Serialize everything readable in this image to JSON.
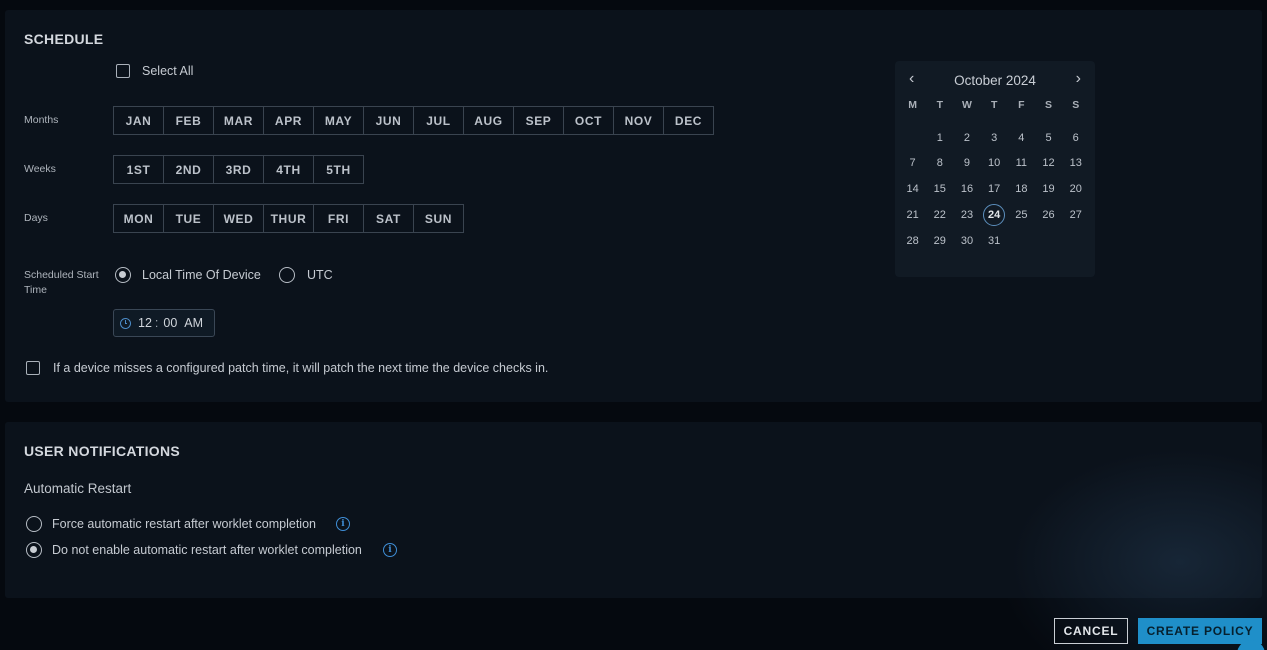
{
  "schedule": {
    "title": "SCHEDULE",
    "select_all": "Select All",
    "months_label": "Months",
    "months": [
      "JAN",
      "FEB",
      "MAR",
      "APR",
      "MAY",
      "JUN",
      "JUL",
      "AUG",
      "SEP",
      "OCT",
      "NOV",
      "DEC"
    ],
    "weeks_label": "Weeks",
    "weeks": [
      "1ST",
      "2ND",
      "3RD",
      "4TH",
      "5TH"
    ],
    "days_label": "Days",
    "days": [
      "MON",
      "TUE",
      "WED",
      "THUR",
      "FRI",
      "SAT",
      "SUN"
    ],
    "start_time_label": "Scheduled Start Time",
    "tz_local": "Local Time Of Device",
    "tz_utc": "UTC",
    "time_hour": "12",
    "time_minute": "00",
    "time_ampm": "AM",
    "missed_patch": "If a device misses a configured patch time, it will patch the next time the device checks in."
  },
  "calendar": {
    "month_label": "October 2024",
    "prev_icon": "chevron-left-icon",
    "next_icon": "chevron-right-icon",
    "weekdays": [
      "M",
      "T",
      "W",
      "T",
      "F",
      "S",
      "S"
    ],
    "first_weekday_offset": 1,
    "days_in_month": 31,
    "today": 24
  },
  "notifications": {
    "title": "USER NOTIFICATIONS",
    "subtitle": "Automatic Restart",
    "option_force": "Force automatic restart after worklet completion",
    "option_disable": "Do not enable automatic restart after worklet completion",
    "info_glyph": "i"
  },
  "footer": {
    "cancel_label": "CANCEL",
    "create_label": "CREATE POLICY"
  },
  "colors": {
    "accent": "#1f8fc9",
    "panel": "#0b121b",
    "background": "#05090f"
  }
}
